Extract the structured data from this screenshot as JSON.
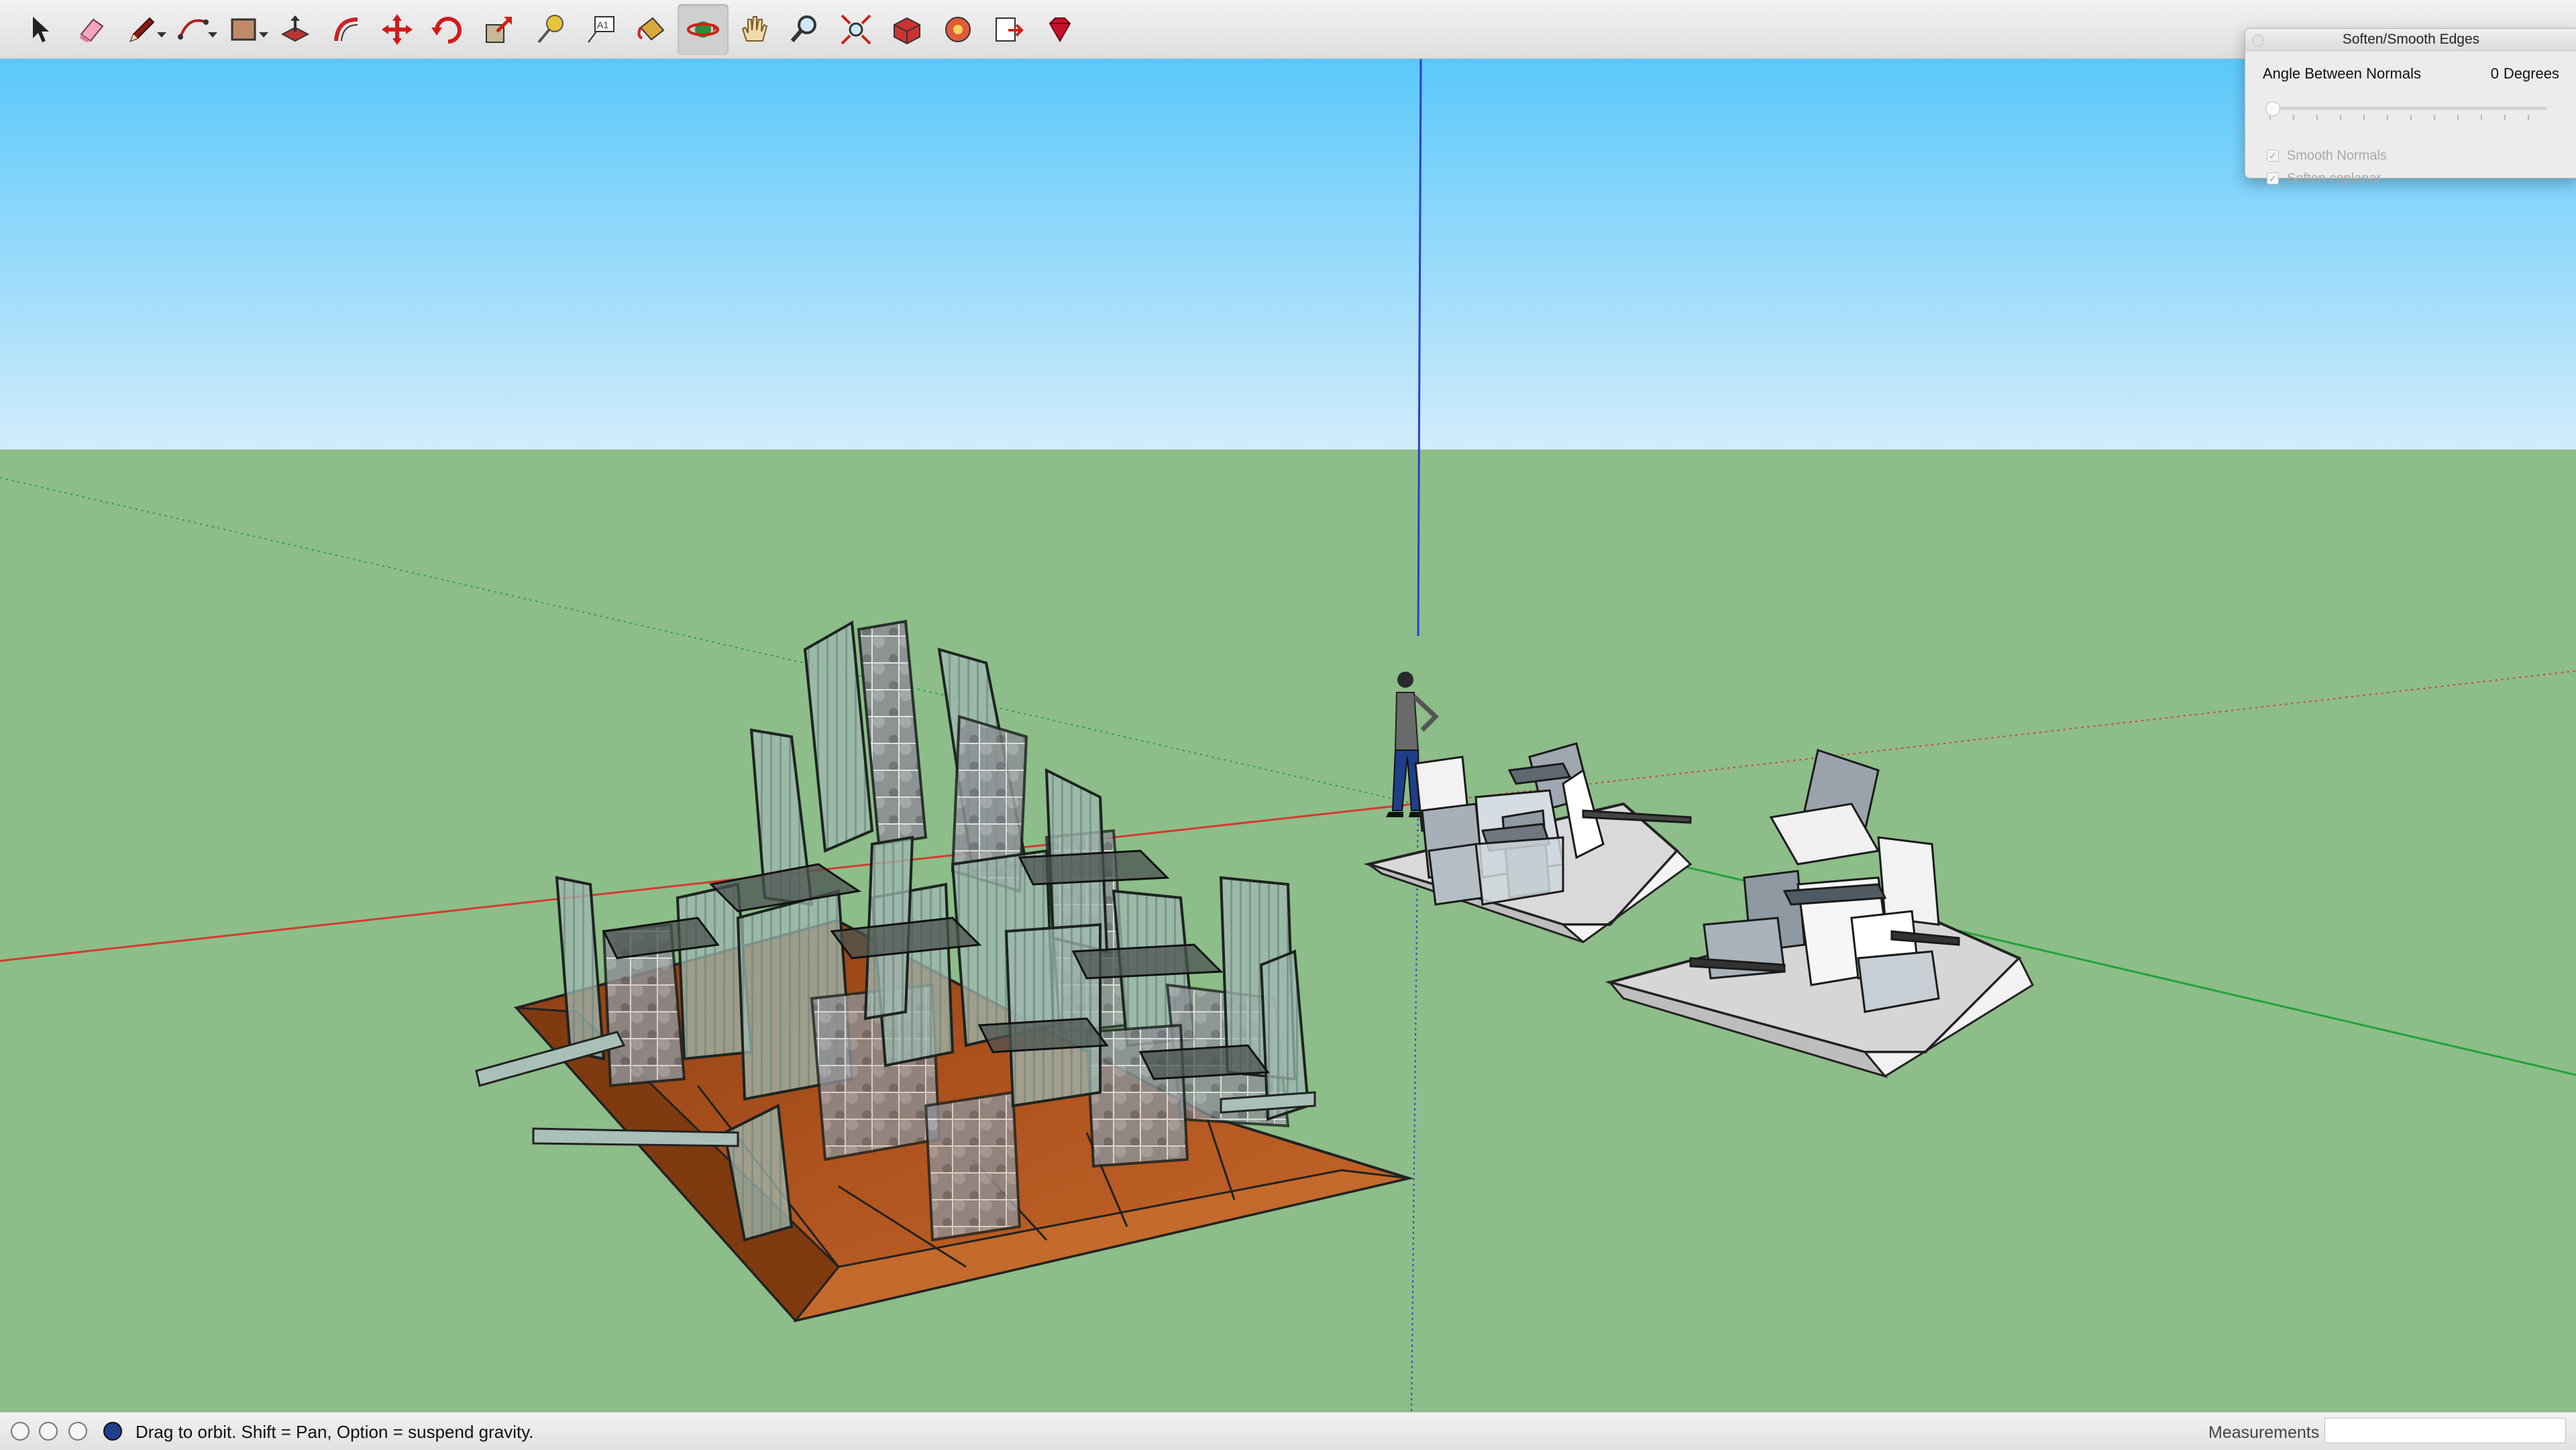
{
  "toolbar": {
    "tools": [
      {
        "icon": "select-arrow-icon"
      },
      {
        "icon": "eraser-icon"
      },
      {
        "icon": "pencil-line-icon"
      },
      {
        "icon": "arc-icon"
      },
      {
        "icon": "rectangle-icon"
      },
      {
        "icon": "push-pull-icon"
      },
      {
        "icon": "offset-icon"
      },
      {
        "icon": "move-icon"
      },
      {
        "icon": "rotate-icon"
      },
      {
        "icon": "scale-icon"
      },
      {
        "icon": "tape-measure-icon"
      },
      {
        "icon": "text-icon"
      },
      {
        "icon": "paint-bucket-icon"
      },
      {
        "icon": "orbit-icon",
        "active": true
      },
      {
        "icon": "pan-hand-icon"
      },
      {
        "icon": "zoom-icon"
      },
      {
        "icon": "zoom-extents-icon"
      },
      {
        "icon": "3d-warehouse-icon"
      },
      {
        "icon": "extension-warehouse-icon"
      },
      {
        "icon": "send-to-layout-icon"
      },
      {
        "icon": "ruby-console-icon"
      }
    ]
  },
  "soften_panel": {
    "title": "Soften/Smooth Edges",
    "angle_label": "Angle Between Normals",
    "angle_value": "0",
    "angle_unit": "Degrees",
    "slider_level": 0,
    "smooth_normals_label": "Smooth Normals",
    "smooth_normals_checked": true,
    "soften_coplanar_label": "Soften coplanar",
    "soften_coplanar_checked": true
  },
  "status_bar": {
    "hint": "Drag to orbit. Shift = Pan, Option = suspend gravity.",
    "measurements_label": "Measurements",
    "measurements_value": ""
  },
  "colors": {
    "sky_top": "#5ac8fb",
    "sky_bottom": "#d2ecfb",
    "ground": "#8dbd89",
    "base_wood": "#b0541f",
    "glass_panel": "#8fa7a0",
    "axis_red": "#d33b2c",
    "axis_green": "#22a33a",
    "axis_blue": "#2b3fd0"
  }
}
